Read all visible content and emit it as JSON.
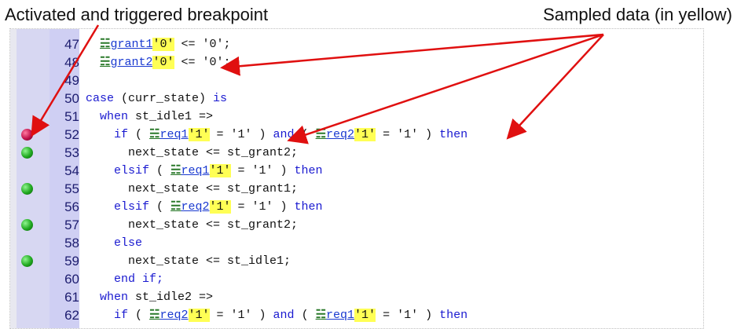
{
  "annotations": {
    "left": "Activated and triggered breakpoint",
    "right": "Sampled data (in yellow)"
  },
  "colors": {
    "value_highlight": "#ffff55",
    "keyword": "#1a1ad0",
    "arrow": "#e01010",
    "breakpoint_green": "#1fa81f",
    "breakpoint_triggered": "#c0104a",
    "gutter": "#cfcff3"
  },
  "icons": {
    "breakpoint": "green-dot",
    "breakpoint_triggered": "red-dot",
    "probe": "glasses-icon"
  },
  "lines": [
    {
      "num": "47",
      "bp": "none",
      "segments": [
        {
          "t": "  "
        },
        {
          "t": "☵",
          "c": "eye"
        },
        {
          "t": "grant1",
          "c": "sig"
        },
        {
          "t": "'0'",
          "c": "val"
        },
        {
          "t": " <= '0';"
        }
      ]
    },
    {
      "num": "48",
      "bp": "none",
      "segments": [
        {
          "t": "  "
        },
        {
          "t": "☵",
          "c": "eye"
        },
        {
          "t": "grant2",
          "c": "sig"
        },
        {
          "t": "'0'",
          "c": "val"
        },
        {
          "t": " <= '0';"
        }
      ]
    },
    {
      "num": "49",
      "bp": "none",
      "segments": [
        {
          "t": ""
        }
      ]
    },
    {
      "num": "50",
      "bp": "none",
      "segments": [
        {
          "t": "case",
          "c": "kw"
        },
        {
          "t": " (curr_state) "
        },
        {
          "t": "is",
          "c": "kw"
        }
      ]
    },
    {
      "num": "51",
      "bp": "none",
      "segments": [
        {
          "t": "  "
        },
        {
          "t": "when",
          "c": "kw"
        },
        {
          "t": " st_idle1 =>"
        }
      ]
    },
    {
      "num": "52",
      "bp": "triggered",
      "segments": [
        {
          "t": "    "
        },
        {
          "t": "if",
          "c": "kw"
        },
        {
          "t": " ( "
        },
        {
          "t": "☵",
          "c": "eye"
        },
        {
          "t": "req1",
          "c": "sig"
        },
        {
          "t": "'1'",
          "c": "val"
        },
        {
          "t": " = '1' ) "
        },
        {
          "t": "and",
          "c": "kw"
        },
        {
          "t": " ( "
        },
        {
          "t": "☵",
          "c": "eye"
        },
        {
          "t": "req2",
          "c": "sig"
        },
        {
          "t": "'1'",
          "c": "val"
        },
        {
          "t": " = '1' ) "
        },
        {
          "t": "then",
          "c": "kw"
        }
      ]
    },
    {
      "num": "53",
      "bp": "active",
      "segments": [
        {
          "t": "      next_state <= st_grant2;"
        }
      ]
    },
    {
      "num": "54",
      "bp": "none",
      "segments": [
        {
          "t": "    "
        },
        {
          "t": "elsif",
          "c": "kw"
        },
        {
          "t": " ( "
        },
        {
          "t": "☵",
          "c": "eye"
        },
        {
          "t": "req1",
          "c": "sig"
        },
        {
          "t": "'1'",
          "c": "val"
        },
        {
          "t": " = '1' ) "
        },
        {
          "t": "then",
          "c": "kw"
        }
      ]
    },
    {
      "num": "55",
      "bp": "active",
      "segments": [
        {
          "t": "      next_state <= st_grant1;"
        }
      ]
    },
    {
      "num": "56",
      "bp": "none",
      "segments": [
        {
          "t": "    "
        },
        {
          "t": "elsif",
          "c": "kw"
        },
        {
          "t": " ( "
        },
        {
          "t": "☵",
          "c": "eye"
        },
        {
          "t": "req2",
          "c": "sig"
        },
        {
          "t": "'1'",
          "c": "val"
        },
        {
          "t": " = '1' ) "
        },
        {
          "t": "then",
          "c": "kw"
        }
      ]
    },
    {
      "num": "57",
      "bp": "active",
      "segments": [
        {
          "t": "      next_state <= st_grant2;"
        }
      ]
    },
    {
      "num": "58",
      "bp": "none",
      "segments": [
        {
          "t": "    "
        },
        {
          "t": "else",
          "c": "kw"
        }
      ]
    },
    {
      "num": "59",
      "bp": "active",
      "segments": [
        {
          "t": "      next_state <= st_idle1;"
        }
      ]
    },
    {
      "num": "60",
      "bp": "none",
      "segments": [
        {
          "t": "    "
        },
        {
          "t": "end if;",
          "c": "kw"
        }
      ]
    },
    {
      "num": "61",
      "bp": "none",
      "segments": [
        {
          "t": "  "
        },
        {
          "t": "when",
          "c": "kw"
        },
        {
          "t": " st_idle2 =>"
        }
      ]
    },
    {
      "num": "62",
      "bp": "none",
      "segments": [
        {
          "t": "    "
        },
        {
          "t": "if",
          "c": "kw"
        },
        {
          "t": " ( "
        },
        {
          "t": "☵",
          "c": "eye"
        },
        {
          "t": "req2",
          "c": "sig"
        },
        {
          "t": "'1'",
          "c": "val"
        },
        {
          "t": " = '1' ) "
        },
        {
          "t": "and",
          "c": "kw"
        },
        {
          "t": " ( "
        },
        {
          "t": "☵",
          "c": "eye"
        },
        {
          "t": "req1",
          "c": "sig"
        },
        {
          "t": "'1'",
          "c": "val"
        },
        {
          "t": " = '1' ) "
        },
        {
          "t": "then",
          "c": "kw"
        }
      ]
    }
  ]
}
